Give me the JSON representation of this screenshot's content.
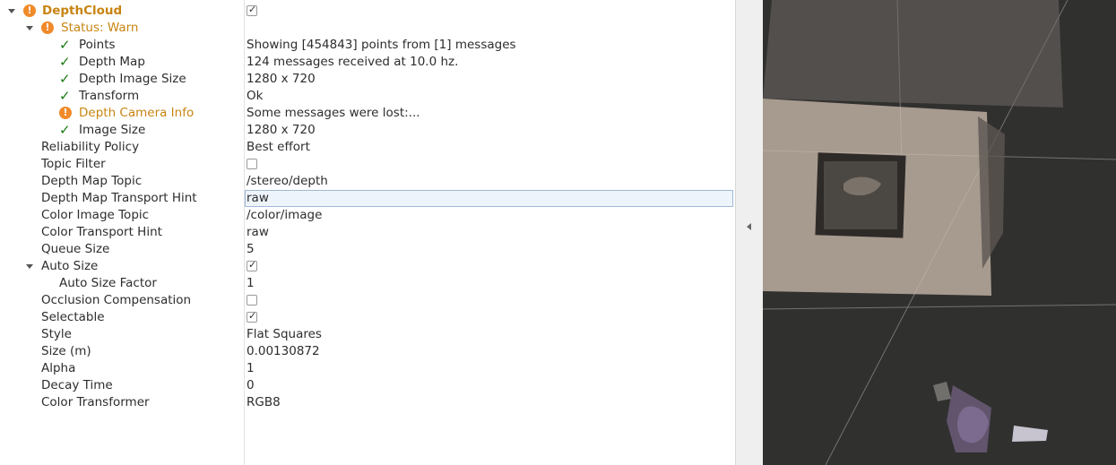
{
  "properties": {
    "display": {
      "name": "DepthCloud",
      "checked": true
    },
    "status": {
      "label": "Status: Warn"
    },
    "status_items": [
      {
        "icon": "check-icon",
        "name": "Points",
        "value": "Showing [454843] points from [1] messages"
      },
      {
        "icon": "check-icon",
        "name": "Depth Map",
        "value": "124 messages received at 10.0 hz."
      },
      {
        "icon": "check-icon",
        "name": "Depth Image Size",
        "value": "1280 x 720"
      },
      {
        "icon": "check-icon",
        "name": "Transform",
        "value": "Ok"
      },
      {
        "icon": "warn-icon",
        "name": "Depth Camera Info",
        "value": "Some messages were lost:..."
      },
      {
        "icon": "check-icon",
        "name": "Image Size",
        "value": "1280 x 720"
      }
    ],
    "rows": {
      "reliability_policy": {
        "name": "Reliability Policy",
        "value": "Best effort"
      },
      "topic_filter": {
        "name": "Topic Filter",
        "checked": false
      },
      "depth_map_topic": {
        "name": "Depth Map Topic",
        "value": "/stereo/depth"
      },
      "depth_map_transport_hint": {
        "name": "Depth Map Transport Hint",
        "value": "raw"
      },
      "color_image_topic": {
        "name": "Color Image Topic",
        "value": "/color/image"
      },
      "color_transport_hint": {
        "name": "Color Transport Hint",
        "value": "raw"
      },
      "queue_size": {
        "name": "Queue Size",
        "value": "5"
      },
      "auto_size": {
        "name": "Auto Size",
        "checked": true
      },
      "auto_size_factor": {
        "name": "Auto Size Factor",
        "value": "1"
      },
      "occlusion_compensation": {
        "name": "Occlusion Compensation",
        "checked": false
      },
      "selectable": {
        "name": "Selectable",
        "checked": true
      },
      "style": {
        "name": "Style",
        "value": "Flat Squares"
      },
      "size_m": {
        "name": "Size (m)",
        "value": "0.00130872"
      },
      "alpha": {
        "name": "Alpha",
        "value": "1"
      },
      "decay_time": {
        "name": "Decay Time",
        "value": "0"
      },
      "color_transformer": {
        "name": "Color Transformer",
        "value": "RGB8"
      }
    }
  },
  "colors": {
    "warning": "#c88412",
    "warning_icon": "#f08a2a",
    "ok_check": "#1a7a12",
    "viewport_background": "#30302f"
  }
}
